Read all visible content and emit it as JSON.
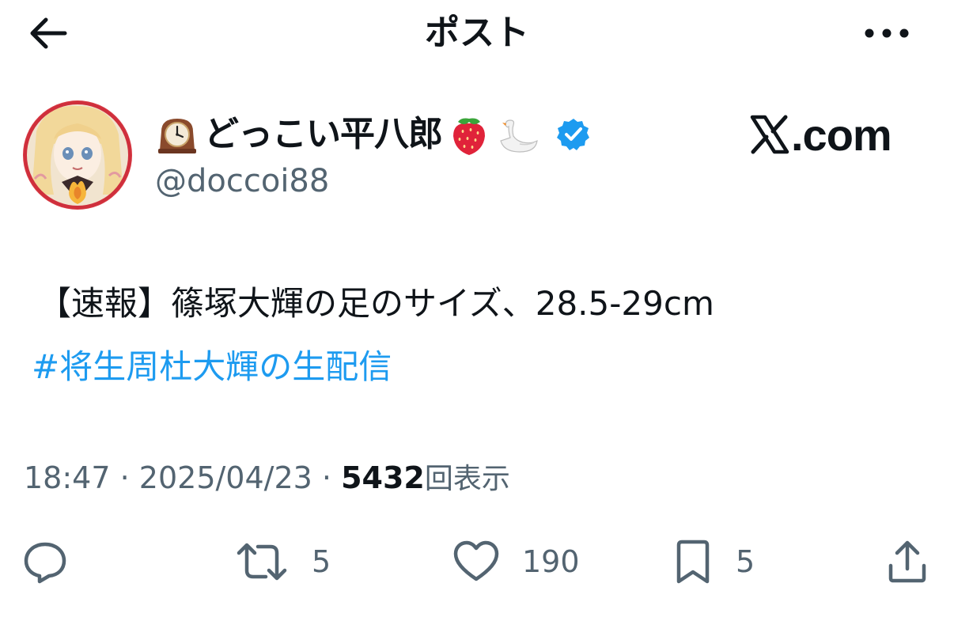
{
  "header": {
    "title": "ポスト",
    "back_icon": "arrow-left-icon",
    "more_icon": "more-horizontal-icon"
  },
  "author": {
    "display_name": "どっこい平八郎",
    "handle": "@doccoi88",
    "verified": true,
    "verified_color": "#1d9bf0",
    "name_emojis_before": [
      "mantelpiece-clock-emoji"
    ],
    "name_emojis_after": [
      "strawberry-emoji",
      "swan-emoji"
    ]
  },
  "watermark": {
    "text": ".com"
  },
  "post": {
    "text": "【速報】篠塚大輝の足のサイズ、28.5-29cm",
    "hashtag": "#将生周杜大輝の生配信",
    "hashtag_color": "#1d9bf0"
  },
  "meta": {
    "time": "18:47",
    "separator": "·",
    "date": "2025/04/23",
    "views": "5432",
    "views_label": "回表示"
  },
  "actions": {
    "reply": {
      "icon": "reply-bubble-icon",
      "count": ""
    },
    "retweet": {
      "icon": "retweet-icon",
      "count": "5"
    },
    "like": {
      "icon": "heart-icon",
      "count": "190"
    },
    "bookmark": {
      "icon": "bookmark-icon",
      "count": "5"
    },
    "share": {
      "icon": "share-icon"
    }
  },
  "colors": {
    "text": "#0f1419",
    "secondary": "#536471",
    "accent": "#1d9bf0"
  }
}
